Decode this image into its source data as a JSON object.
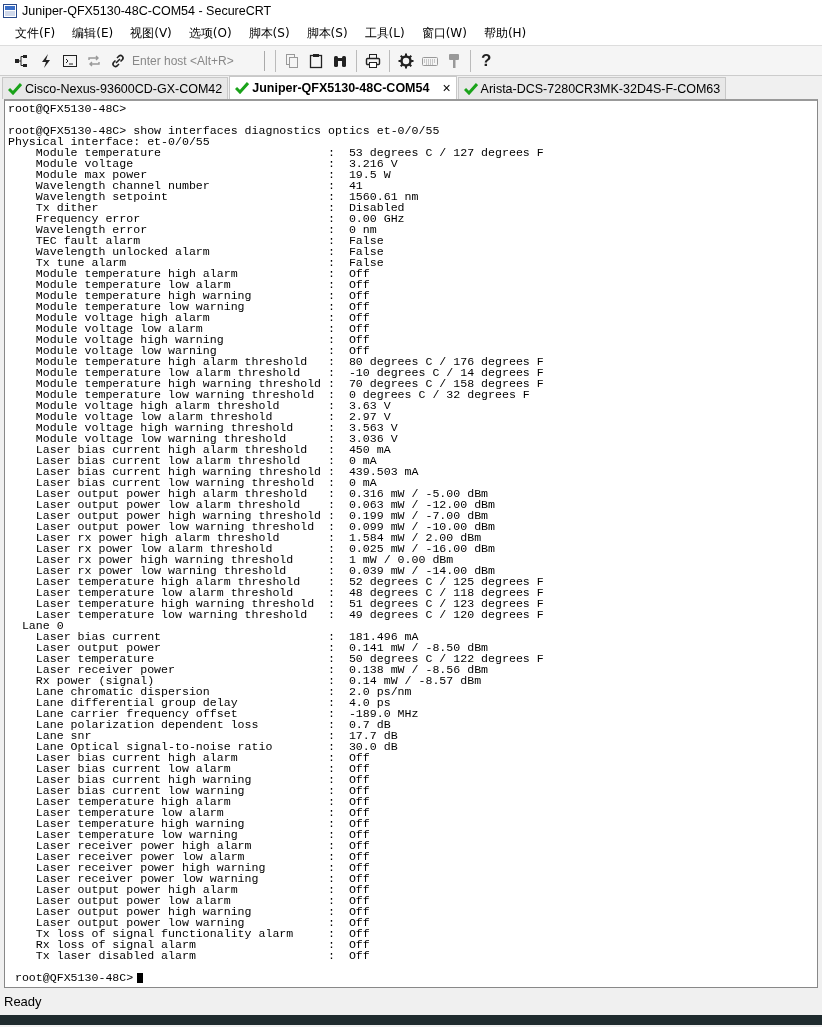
{
  "window": {
    "title": "Juniper-QFX5130-48C-COM54 - SecureCRT"
  },
  "menu": [
    "文件(F)",
    "编辑(E)",
    "视图(V)",
    "选项(O)",
    "脚本(S)",
    "脚本(S)",
    "工具(L)",
    "窗口(W)",
    "帮助(H)"
  ],
  "toolbar": {
    "host_field": {
      "placeholder": "Enter host <Alt+R>"
    },
    "help": "?"
  },
  "tabs": [
    {
      "label": "Cisco-Nexus-93600CD-GX-COM42",
      "selected": false,
      "connected": true
    },
    {
      "label": "Juniper-QFX5130-48C-COM54",
      "selected": true,
      "connected": true,
      "close": "×"
    },
    {
      "label": "Arista-DCS-7280CR3MK-32D4S-F-COM63",
      "selected": false,
      "connected": true
    }
  ],
  "terminal": {
    "lines": [
      {
        "kind": "text",
        "text": "root@QFX5130-48C>"
      },
      {
        "kind": "blank"
      },
      {
        "kind": "text",
        "text": "root@QFX5130-48C> show interfaces diagnostics optics et-0/0/55"
      },
      {
        "kind": "text",
        "text": "Physical interface: et-0/0/55"
      },
      {
        "kind": "pair",
        "label": "Module temperature",
        "value": ":  53 degrees C / 127 degrees F"
      },
      {
        "kind": "pair",
        "label": "Module voltage",
        "value": ":  3.216 V"
      },
      {
        "kind": "pair",
        "label": "Module max power",
        "value": ":  19.5 W"
      },
      {
        "kind": "pair",
        "label": "Wavelength channel number",
        "value": ":  41"
      },
      {
        "kind": "pair",
        "label": "Wavelength setpoint",
        "value": ":  1560.61 nm"
      },
      {
        "kind": "pair",
        "label": "Tx dither",
        "value": ":  Disabled"
      },
      {
        "kind": "pair",
        "label": "Frequency error",
        "value": ":  0.00 GHz"
      },
      {
        "kind": "pair",
        "label": "Wavelength error",
        "value": ":  0 nm"
      },
      {
        "kind": "pair",
        "label": "TEC fault alarm",
        "value": ":  False"
      },
      {
        "kind": "pair",
        "label": "Wavelength unlocked alarm",
        "value": ":  False"
      },
      {
        "kind": "pair",
        "label": "Tx tune alarm",
        "value": ":  False"
      },
      {
        "kind": "pair",
        "label": "Module temperature high alarm",
        "value": ":  Off"
      },
      {
        "kind": "pair",
        "label": "Module temperature low alarm",
        "value": ":  Off"
      },
      {
        "kind": "pair",
        "label": "Module temperature high warning",
        "value": ":  Off"
      },
      {
        "kind": "pair",
        "label": "Module temperature low warning",
        "value": ":  Off"
      },
      {
        "kind": "pair",
        "label": "Module voltage high alarm",
        "value": ":  Off"
      },
      {
        "kind": "pair",
        "label": "Module voltage low alarm",
        "value": ":  Off"
      },
      {
        "kind": "pair",
        "label": "Module voltage high warning",
        "value": ":  Off"
      },
      {
        "kind": "pair",
        "label": "Module voltage low warning",
        "value": ":  Off"
      },
      {
        "kind": "pair",
        "label": "Module temperature high alarm threshold",
        "value": ":  80 degrees C / 176 degrees F"
      },
      {
        "kind": "pair",
        "label": "Module temperature low alarm threshold",
        "value": ":  -10 degrees C / 14 degrees F"
      },
      {
        "kind": "pair",
        "label": "Module temperature high warning threshold",
        "value": ":  70 degrees C / 158 degrees F"
      },
      {
        "kind": "pair",
        "label": "Module temperature low warning threshold",
        "value": ":  0 degrees C / 32 degrees F"
      },
      {
        "kind": "pair",
        "label": "Module voltage high alarm threshold",
        "value": ":  3.63 V"
      },
      {
        "kind": "pair",
        "label": "Module voltage low alarm threshold",
        "value": ":  2.97 V"
      },
      {
        "kind": "pair",
        "label": "Module voltage high warning threshold",
        "value": ":  3.563 V"
      },
      {
        "kind": "pair",
        "label": "Module voltage low warning threshold",
        "value": ":  3.036 V"
      },
      {
        "kind": "pair",
        "label": "Laser bias current high alarm threshold",
        "value": ":  450 mA"
      },
      {
        "kind": "pair",
        "label": "Laser bias current low alarm threshold",
        "value": ":  0 mA"
      },
      {
        "kind": "pair",
        "label": "Laser bias current high warning threshold",
        "value": ":  439.503 mA"
      },
      {
        "kind": "pair",
        "label": "Laser bias current low warning threshold",
        "value": ":  0 mA"
      },
      {
        "kind": "pair",
        "label": "Laser output power high alarm threshold",
        "value": ":  0.316 mW / -5.00 dBm"
      },
      {
        "kind": "pair",
        "label": "Laser output power low alarm threshold",
        "value": ":  0.063 mW / -12.00 dBm"
      },
      {
        "kind": "pair",
        "label": "Laser output power high warning threshold",
        "value": ":  0.199 mW / -7.00 dBm"
      },
      {
        "kind": "pair",
        "label": "Laser output power low warning threshold",
        "value": ":  0.099 mW / -10.00 dBm"
      },
      {
        "kind": "pair",
        "label": "Laser rx power high alarm threshold",
        "value": ":  1.584 mW / 2.00 dBm"
      },
      {
        "kind": "pair",
        "label": "Laser rx power low alarm threshold",
        "value": ":  0.025 mW / -16.00 dBm"
      },
      {
        "kind": "pair",
        "label": "Laser rx power high warning threshold",
        "value": ":  1 mW / 0.00 dBm"
      },
      {
        "kind": "pair",
        "label": "Laser rx power low warning threshold",
        "value": ":  0.039 mW / -14.00 dBm"
      },
      {
        "kind": "pair",
        "label": "Laser temperature high alarm threshold",
        "value": ":  52 degrees C / 125 degrees F"
      },
      {
        "kind": "pair",
        "label": "Laser temperature low alarm threshold",
        "value": ":  48 degrees C / 118 degrees F"
      },
      {
        "kind": "pair",
        "label": "Laser temperature high warning threshold",
        "value": ":  51 degrees C / 123 degrees F"
      },
      {
        "kind": "pair",
        "label": "Laser temperature low warning threshold",
        "value": ":  49 degrees C / 120 degrees F"
      },
      {
        "kind": "section",
        "text": "Lane 0"
      },
      {
        "kind": "pair",
        "label": "Laser bias current",
        "value": ":  181.496 mA"
      },
      {
        "kind": "pair",
        "label": "Laser output power",
        "value": ":  0.141 mW / -8.50 dBm"
      },
      {
        "kind": "pair",
        "label": "Laser temperature",
        "value": ":  50 degrees C / 122 degrees F"
      },
      {
        "kind": "pair",
        "label": "Laser receiver power",
        "value": ":  0.138 mW / -8.56 dBm"
      },
      {
        "kind": "pair",
        "label": "Rx power (signal)",
        "value": ":  0.14 mW / -8.57 dBm"
      },
      {
        "kind": "pair",
        "label": "Lane chromatic dispersion",
        "value": ":  2.0 ps/nm"
      },
      {
        "kind": "pair",
        "label": "Lane differential group delay",
        "value": ":  4.0 ps"
      },
      {
        "kind": "pair",
        "label": "Lane carrier frequency offset",
        "value": ":  -189.0 MHz"
      },
      {
        "kind": "pair",
        "label": "Lane polarization dependent loss",
        "value": ":  0.7 dB"
      },
      {
        "kind": "pair",
        "label": "Lane snr",
        "value": ":  17.7 dB"
      },
      {
        "kind": "pair",
        "label": "Lane Optical signal-to-noise ratio",
        "value": ":  30.0 dB"
      },
      {
        "kind": "pair",
        "label": "Laser bias current high alarm",
        "value": ":  Off"
      },
      {
        "kind": "pair",
        "label": "Laser bias current low alarm",
        "value": ":  Off"
      },
      {
        "kind": "pair",
        "label": "Laser bias current high warning",
        "value": ":  Off"
      },
      {
        "kind": "pair",
        "label": "Laser bias current low warning",
        "value": ":  Off"
      },
      {
        "kind": "pair",
        "label": "Laser temperature high alarm",
        "value": ":  Off"
      },
      {
        "kind": "pair",
        "label": "Laser temperature low alarm",
        "value": ":  Off"
      },
      {
        "kind": "pair",
        "label": "Laser temperature high warning",
        "value": ":  Off"
      },
      {
        "kind": "pair",
        "label": "Laser temperature low warning",
        "value": ":  Off"
      },
      {
        "kind": "pair",
        "label": "Laser receiver power high alarm",
        "value": ":  Off"
      },
      {
        "kind": "pair",
        "label": "Laser receiver power low alarm",
        "value": ":  Off"
      },
      {
        "kind": "pair",
        "label": "Laser receiver power high warning",
        "value": ":  Off"
      },
      {
        "kind": "pair",
        "label": "Laser receiver power low warning",
        "value": ":  Off"
      },
      {
        "kind": "pair",
        "label": "Laser output power high alarm",
        "value": ":  Off"
      },
      {
        "kind": "pair",
        "label": "Laser output power low alarm",
        "value": ":  Off"
      },
      {
        "kind": "pair",
        "label": "Laser output power high warning",
        "value": ":  Off"
      },
      {
        "kind": "pair",
        "label": "Laser output power low warning",
        "value": ":  Off"
      },
      {
        "kind": "pair",
        "label": "Tx loss of signal functionality alarm",
        "value": ":  Off"
      },
      {
        "kind": "pair",
        "label": "Rx loss of signal alarm",
        "value": ":  Off"
      },
      {
        "kind": "pair",
        "label": "Tx laser disabled alarm",
        "value": ":  Off"
      },
      {
        "kind": "blank"
      },
      {
        "kind": "prompt",
        "text": "root@QFX5130-48C>"
      }
    ]
  },
  "status_bar": {
    "text": "Ready"
  }
}
